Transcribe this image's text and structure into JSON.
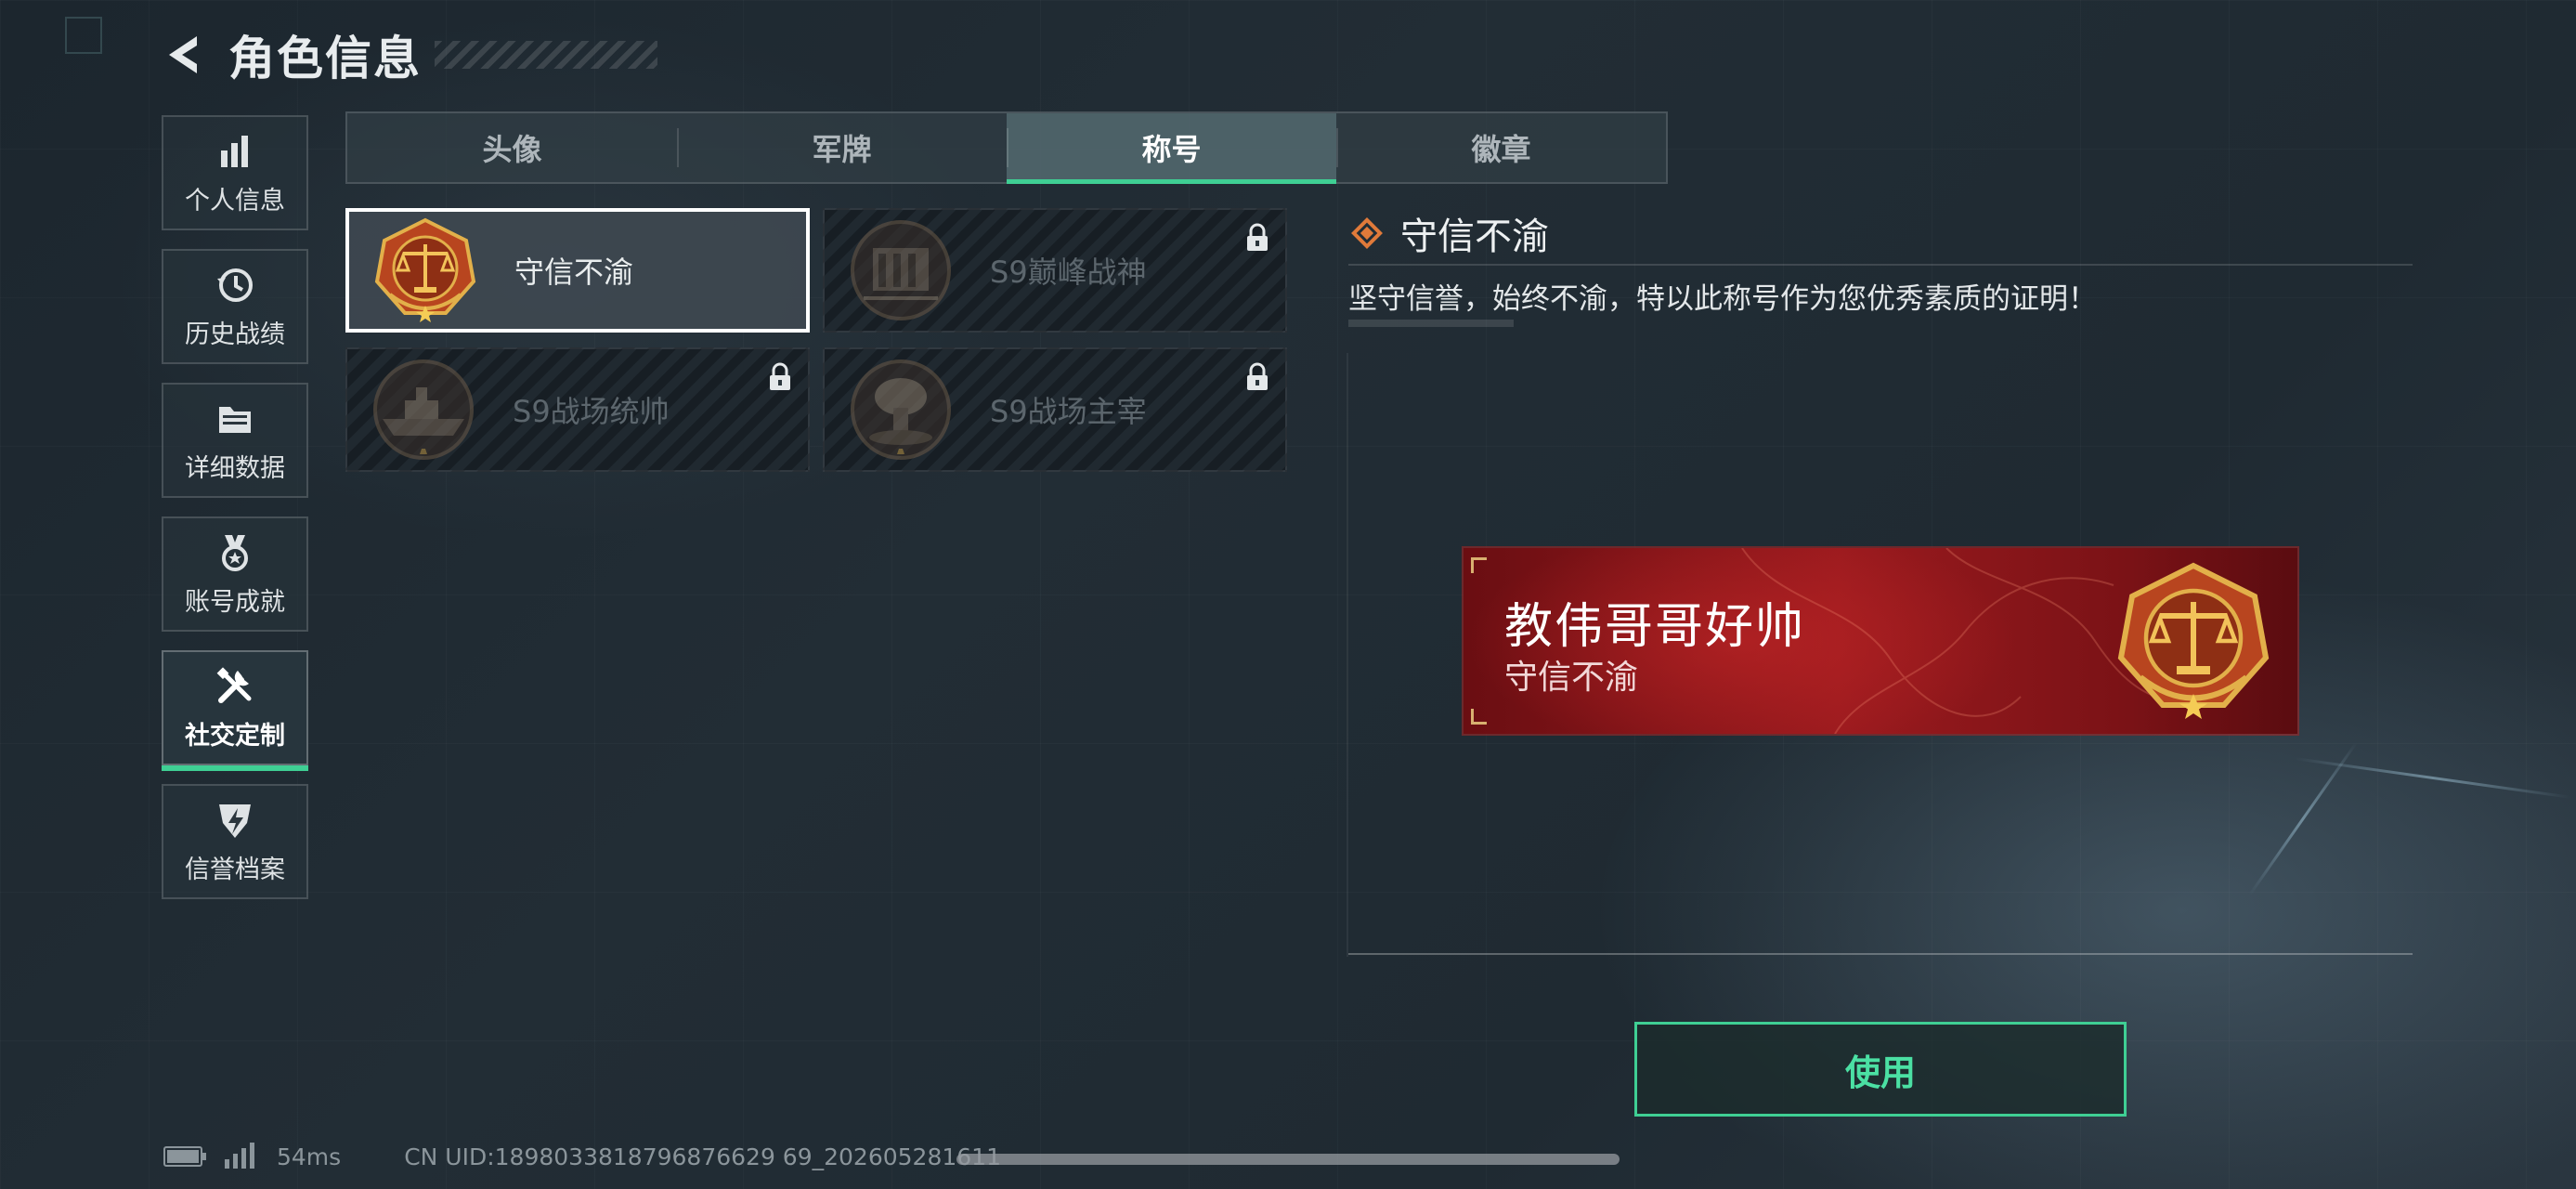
{
  "header": {
    "title": "角色信息"
  },
  "sidebar": {
    "items": [
      {
        "label": "个人信息",
        "icon": "bar-chart-icon",
        "active": false
      },
      {
        "label": "历史战绩",
        "icon": "clock-history-icon",
        "active": false
      },
      {
        "label": "详细数据",
        "icon": "folder-icon",
        "active": false
      },
      {
        "label": "账号成就",
        "icon": "medal-icon",
        "active": false
      },
      {
        "label": "社交定制",
        "icon": "tools-icon",
        "active": true
      },
      {
        "label": "信誉档案",
        "icon": "shield-icon",
        "active": false
      }
    ]
  },
  "tabs": [
    {
      "label": "头像",
      "active": false
    },
    {
      "label": "军牌",
      "active": false
    },
    {
      "label": "称号",
      "active": true
    },
    {
      "label": "徽章",
      "active": false
    }
  ],
  "titles": [
    {
      "name": "守信不渝",
      "locked": false,
      "selected": true,
      "emblem": "scales-emblem"
    },
    {
      "name": "S9巅峰战神",
      "locked": true,
      "selected": false,
      "emblem": "building-emblem"
    },
    {
      "name": "S9战场统帅",
      "locked": true,
      "selected": false,
      "emblem": "warship-emblem"
    },
    {
      "name": "S9战场主宰",
      "locked": true,
      "selected": false,
      "emblem": "mushroom-cloud-emblem"
    }
  ],
  "detail": {
    "title": "守信不渝",
    "description": "坚守信誉，始终不渝，特以此称号作为您优秀素质的证明！"
  },
  "preview": {
    "player_name": "教伟哥哥好帅",
    "title_name": "守信不渝"
  },
  "actions": {
    "use_label": "使用"
  },
  "status": {
    "latency": "54ms",
    "uid": "CN UID:1898033818796876629 69_202605281611"
  },
  "colors": {
    "accent_green": "#3fcf94",
    "banner_red": "#9a1a1e",
    "emblem_orange": "#c0542a",
    "emblem_gold": "#e2b04a"
  }
}
